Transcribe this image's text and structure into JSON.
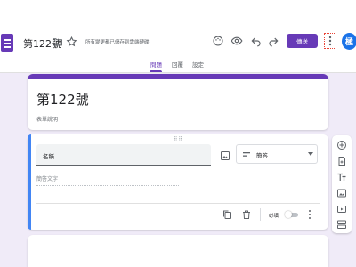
{
  "app": {
    "doc_title": "第122號",
    "saved_status": "所有變更都已儲存到雲端硬碟",
    "send_label": "傳送",
    "avatar_initial": "極",
    "accent_color": "#673ab7",
    "icons": [
      "app-logo-icon",
      "folder-icon",
      "star-icon",
      "palette-icon",
      "preview-eye-icon",
      "undo-icon",
      "redo-icon",
      "more-vert-icon"
    ]
  },
  "tabs": [
    {
      "label": "問題",
      "active": true
    },
    {
      "label": "回覆",
      "active": false
    },
    {
      "label": "設定",
      "active": false
    }
  ],
  "form": {
    "title": "第122號",
    "description": "表單說明"
  },
  "question": {
    "title": "名稱",
    "type": "簡答",
    "answer_placeholder": "簡答文字",
    "required_label": "必填",
    "required": false,
    "icons": [
      "image-icon",
      "short-answer-icon",
      "copy-icon",
      "delete-icon",
      "more-vert-icon"
    ]
  },
  "side_toolbar": {
    "icons": [
      "add-question-icon",
      "import-questions-icon",
      "add-title-icon",
      "add-image-icon",
      "add-video-icon",
      "add-section-icon"
    ]
  }
}
